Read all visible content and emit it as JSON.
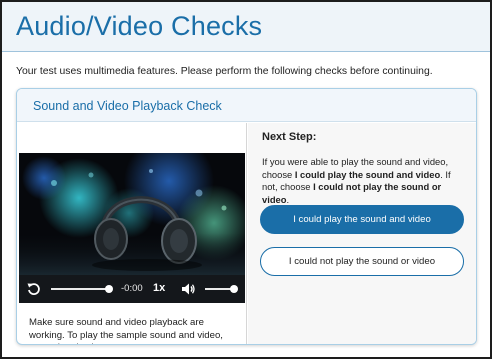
{
  "page": {
    "title": "Audio/Video Checks",
    "intro": "Your test uses multimedia features. Please perform the following checks before continuing."
  },
  "panel": {
    "title": "Sound and Video Playback Check",
    "player": {
      "time": "-0:00",
      "speed": "1x",
      "seek_progress": 0.97,
      "volume_level": 0.95,
      "icons": [
        "replay-icon",
        "volume-icon"
      ]
    },
    "instructions": "Make sure sound and video playback are working. To play the sample sound and video, press the play button.",
    "next_step": {
      "label": "Next Step:",
      "desc_part1": "If you were able to play the sound and video, choose ",
      "desc_bold1": "I could play the sound and video",
      "desc_part2": ". If not, choose ",
      "desc_bold2": "I could not play the sound or video",
      "desc_part3": "."
    },
    "buttons": {
      "yes": "I could play the sound and video",
      "no": "I could not play the sound or video"
    }
  },
  "colors": {
    "accent": "#1a6ea8",
    "header_bg": "#eef4f9",
    "player_bg": "#14171b"
  }
}
